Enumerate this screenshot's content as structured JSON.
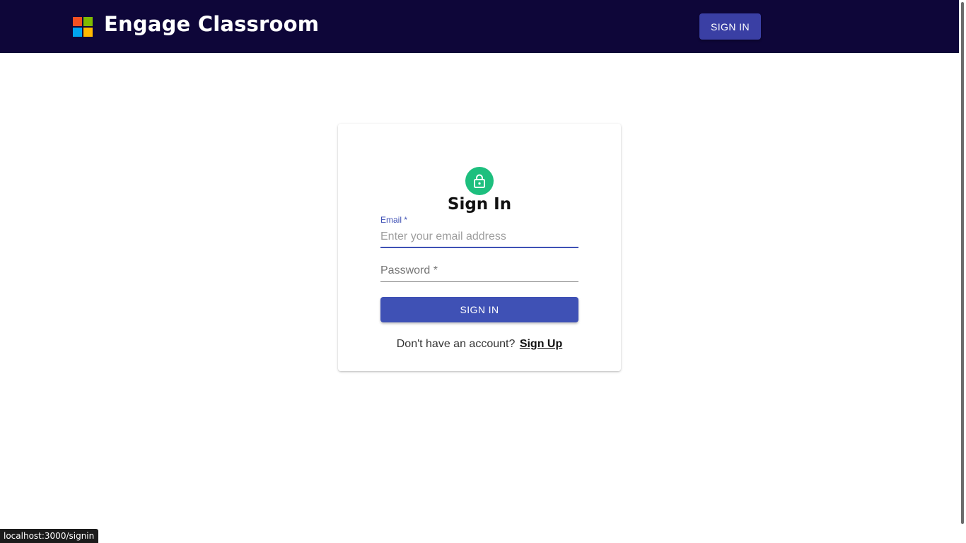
{
  "header": {
    "brand": "Engage Classroom",
    "logo_icon": "microsoft-logo-icon",
    "signin_label": "SIGN IN",
    "background": "#0e0639"
  },
  "card": {
    "icon": "lock-icon",
    "icon_color": "#1dbf7e",
    "title": "Sign In",
    "email_label": "Email *",
    "email_placeholder": "Enter your email address",
    "email_value": "",
    "password_label": "Password *",
    "submit_label": "SIGN IN",
    "footer_text": "Don't have an account?",
    "signup_label": "Sign Up",
    "accent": "#3f51b5"
  },
  "status_bar": {
    "url": "localhost:3000/signin"
  }
}
